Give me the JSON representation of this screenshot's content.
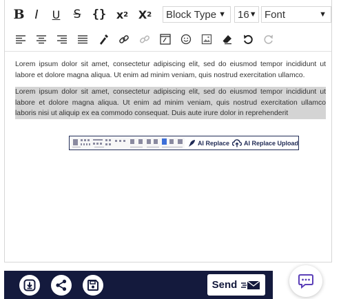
{
  "toolbar": {
    "bold": "B",
    "italic": "I",
    "underline": "U",
    "strike": "S",
    "code": "{}",
    "superscript": "x",
    "superscript_mark": "2",
    "subscript": "X",
    "subscript_mark": "2",
    "block_type": "Block Type",
    "font_size": "16",
    "font": "Font",
    "row2_icons": [
      "align-left-icon",
      "align-center-icon",
      "align-right-icon",
      "align-justify-icon",
      "color-picker-icon",
      "link-icon",
      "unlink-icon",
      "embed-icon",
      "emoji-icon",
      "image-icon",
      "eraser-icon",
      "undo-icon",
      "redo-icon"
    ]
  },
  "content": {
    "paragraph1": "Lorem ipsum dolor sit amet, consectetur adipiscing elit, sed do eiusmod tempor incididunt ut labore et dolore magna aliqua. Ut enim ad minim veniam, quis nostrud exercitation ullamco.",
    "paragraph2": "Lorem ipsum dolor sit amet, consectetur adipiscing elit, sed do eiusmod tempor incididunt ut labore et dolore magna aliqua. Ut enim ad minim veniam, quis nostrud exercitation ullamco laboris nisi ut aliquip ex ea commodo consequat. Duis aute irure dolor in reprehenderit"
  },
  "embed": {
    "ai_replace": "AI Replace",
    "ai_replace_upload": "AI Replace Upload"
  },
  "bottom_bar": {
    "send_label": "Send",
    "icons": [
      "download-icon",
      "share-icon",
      "save-icon",
      "send-mail-icon",
      "chat-icon"
    ]
  },
  "colors": {
    "navy": "#141a3d",
    "chat_accent": "#5b3fb8",
    "highlight": "#d4d4d4"
  }
}
